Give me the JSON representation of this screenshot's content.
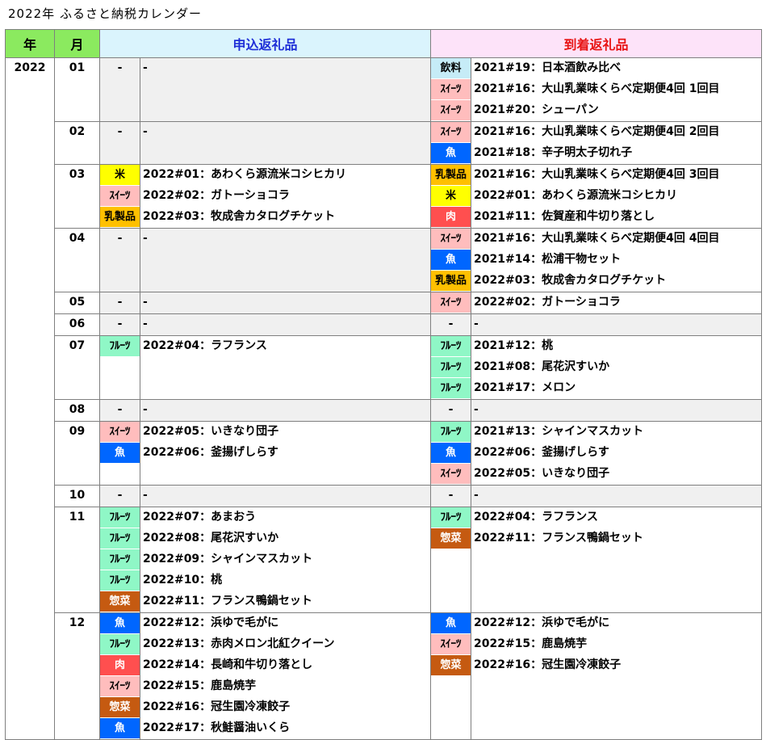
{
  "title": "2022年 ふるさと納税カレンダー",
  "headers": {
    "year": "年",
    "month": "月",
    "apply": "申込返礼品",
    "arrive": "到着返礼品"
  },
  "year": "2022",
  "categories": {
    "rice": {
      "label": "米",
      "bg": "#ffff00",
      "fg": "#000000"
    },
    "sweet": {
      "label": "ｽｲｰﾂ",
      "bg": "#ffbdbd",
      "fg": "#000000"
    },
    "dairy": {
      "label": "乳製品",
      "bg": "#ffc000",
      "fg": "#000000"
    },
    "fruit": {
      "label": "ﾌﾙｰﾂ",
      "bg": "#8ff7c6",
      "fg": "#000000"
    },
    "fish": {
      "label": "魚",
      "bg": "#0066ff",
      "fg": "#ffffff"
    },
    "meat": {
      "label": "肉",
      "bg": "#ff4f4f",
      "fg": "#ffffff"
    },
    "side": {
      "label": "惣菜",
      "bg": "#c55a11",
      "fg": "#ffffff"
    },
    "drink": {
      "label": "飲料",
      "bg": "#c6ecf7",
      "fg": "#000000"
    }
  },
  "dash": "-",
  "months": [
    {
      "m": "01",
      "apply": [],
      "arrive": [
        {
          "cat": "drink",
          "text": "2021#19：日本酒飲み比べ"
        },
        {
          "cat": "sweet",
          "text": "2021#16：大山乳業味くらべ定期便4回 1回目"
        },
        {
          "cat": "sweet",
          "text": "2021#20：シューパン"
        }
      ]
    },
    {
      "m": "02",
      "apply": [],
      "arrive": [
        {
          "cat": "sweet",
          "text": "2021#16：大山乳業味くらべ定期便4回 2回目"
        },
        {
          "cat": "fish",
          "text": "2021#18：辛子明太子切れ子"
        }
      ]
    },
    {
      "m": "03",
      "apply": [
        {
          "cat": "rice",
          "text": "2022#01：あわくら源流米コシヒカリ"
        },
        {
          "cat": "sweet",
          "text": "2022#02：ガトーショコラ"
        },
        {
          "cat": "dairy",
          "text": "2022#03：牧成舎カタログチケット"
        }
      ],
      "arrive": [
        {
          "cat": "dairy",
          "text": "2021#16：大山乳業味くらべ定期便4回 3回目"
        },
        {
          "cat": "rice",
          "text": "2022#01：あわくら源流米コシヒカリ"
        },
        {
          "cat": "meat",
          "text": "2021#11：佐賀産和牛切り落とし"
        }
      ]
    },
    {
      "m": "04",
      "apply": [],
      "arrive": [
        {
          "cat": "sweet",
          "text": "2021#16：大山乳業味くらべ定期便4回 4回目"
        },
        {
          "cat": "fish",
          "text": "2021#14：松浦干物セット"
        },
        {
          "cat": "dairy",
          "text": "2022#03：牧成舎カタログチケット"
        }
      ]
    },
    {
      "m": "05",
      "apply": [],
      "arrive": [
        {
          "cat": "sweet",
          "text": "2022#02：ガトーショコラ"
        }
      ]
    },
    {
      "m": "06",
      "apply": [],
      "arrive": []
    },
    {
      "m": "07",
      "apply": [
        {
          "cat": "fruit",
          "text": "2022#04：ラフランス"
        }
      ],
      "arrive": [
        {
          "cat": "fruit",
          "text": "2021#12：桃"
        },
        {
          "cat": "fruit",
          "text": "2021#08：尾花沢すいか"
        },
        {
          "cat": "fruit",
          "text": "2021#17：メロン"
        }
      ]
    },
    {
      "m": "08",
      "apply": [],
      "arrive": []
    },
    {
      "m": "09",
      "apply": [
        {
          "cat": "sweet",
          "text": "2022#05：いきなり団子"
        },
        {
          "cat": "fish",
          "text": "2022#06：釜揚げしらす"
        }
      ],
      "arrive": [
        {
          "cat": "fruit",
          "text": "2021#13：シャインマスカット"
        },
        {
          "cat": "fish",
          "text": "2022#06：釜揚げしらす"
        },
        {
          "cat": "sweet",
          "text": "2022#05：いきなり団子"
        }
      ]
    },
    {
      "m": "10",
      "apply": [],
      "arrive": []
    },
    {
      "m": "11",
      "apply": [
        {
          "cat": "fruit",
          "text": "2022#07：あまおう"
        },
        {
          "cat": "fruit",
          "text": "2022#08：尾花沢すいか"
        },
        {
          "cat": "fruit",
          "text": "2022#09：シャインマスカット"
        },
        {
          "cat": "fruit",
          "text": "2022#10：桃"
        },
        {
          "cat": "side",
          "text": "2022#11：フランス鴨鍋セット"
        }
      ],
      "arrive": [
        {
          "cat": "fruit",
          "text": "2022#04：ラフランス"
        },
        {
          "cat": "side",
          "text": "2022#11：フランス鴨鍋セット"
        }
      ]
    },
    {
      "m": "12",
      "apply": [
        {
          "cat": "fish",
          "text": "2022#12：浜ゆで毛がに"
        },
        {
          "cat": "fruit",
          "text": "2022#13：赤肉メロン北紅クイーン"
        },
        {
          "cat": "meat",
          "text": "2022#14：長崎和牛切り落とし"
        },
        {
          "cat": "sweet",
          "text": "2022#15：鹿島焼芋"
        },
        {
          "cat": "side",
          "text": "2022#16：冠生園冷凍餃子"
        },
        {
          "cat": "fish",
          "text": "2022#17：秋鮭醤油いくら"
        }
      ],
      "arrive": [
        {
          "cat": "fish",
          "text": "2022#12：浜ゆで毛がに"
        },
        {
          "cat": "sweet",
          "text": "2022#15：鹿島焼芋"
        },
        {
          "cat": "side",
          "text": "2022#16：冠生園冷凍餃子"
        }
      ]
    }
  ]
}
